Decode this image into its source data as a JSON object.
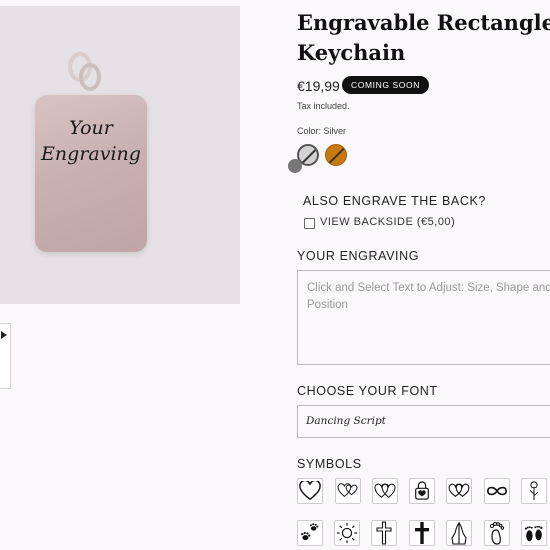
{
  "product": {
    "title": "Engravable Rectangle Keychain",
    "price": "€19,99",
    "badge": "COMING SOON",
    "tax_note": "Tax included.",
    "color_label": "Color: Silver"
  },
  "preview": {
    "line1": "Your",
    "line2": "Engraving"
  },
  "colors": {
    "swatches": [
      {
        "name": "Silver",
        "hex": "#d2d2d2",
        "selected": true
      },
      {
        "name": "Gold",
        "hex": "#c8790e",
        "selected": false
      }
    ]
  },
  "back_option": {
    "title": "ALSO ENGRAVE THE BACK?",
    "checkbox_label": "VIEW BACKSIDE",
    "checkbox_price": "(€5,00)",
    "checked": false
  },
  "engraving": {
    "title": "YOUR ENGRAVING",
    "placeholder": "Click and Select Text to Adjust: Size, Shape and Position"
  },
  "font": {
    "title": "CHOOSE YOUR FONT",
    "selected": "Dancing Script"
  },
  "symbols": {
    "title": "SYMBOLS",
    "row1": [
      "heart-icon",
      "double-heart-icon",
      "interlocked-hearts-icon",
      "heart-lock-icon",
      "linked-hearts-icon",
      "infinity-icon",
      "rose-icon"
    ],
    "row2": [
      "paw-prints-icon",
      "sun-icon",
      "cross-outline-icon",
      "cross-solid-icon",
      "praying-hands-icon",
      "foot-outline-icon",
      "baby-feet-icon"
    ]
  }
}
